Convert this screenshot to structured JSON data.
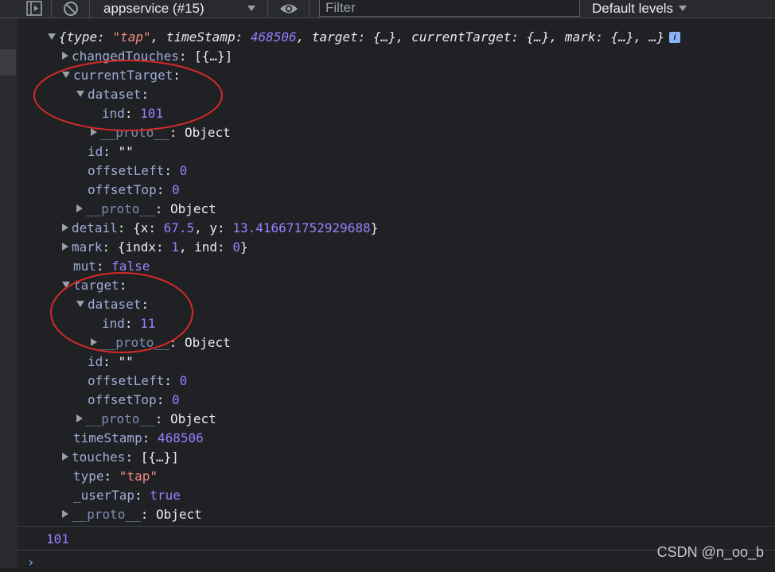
{
  "toolbar": {
    "context": "appservice (#15)",
    "filter_placeholder": "Filter",
    "levels": "Default levels"
  },
  "summary": {
    "open": "{",
    "type_key": "type",
    "type_val": "\"tap\"",
    "ts_key": "timeStamp",
    "ts_val": "468506",
    "target_key": "target",
    "target_val": "{…}",
    "ct_key": "currentTarget",
    "ct_val": "{…}",
    "mark_key": "mark",
    "mark_val": "{…}",
    "tail": ", …}",
    "info": "i"
  },
  "tree": {
    "changedTouches_key": "changedTouches",
    "changedTouches_val": "[{…}]",
    "currentTarget_key": "currentTarget",
    "ct_dataset_key": "dataset",
    "ct_ind_key": "ind",
    "ct_ind_val": "101",
    "proto_key": "__proto__",
    "proto_val": "Object",
    "id_key": "id",
    "id_val": "\"\"",
    "offsetLeft_key": "offsetLeft",
    "offsetLeft_val": "0",
    "offsetTop_key": "offsetTop",
    "offsetTop_val": "0",
    "detail_key": "detail",
    "detail_x_key": "x",
    "detail_x_val": "67.5",
    "detail_y_key": "y",
    "detail_y_val": "13.416671752929688",
    "mark_key": "mark",
    "mark_indx_key": "indx",
    "mark_indx_val": "1",
    "mark_ind_key": "ind",
    "mark_ind_val": "0",
    "mut_key": "mut",
    "mut_val": "false",
    "target_key": "target",
    "t_dataset_key": "dataset",
    "t_ind_key": "ind",
    "t_ind_val": "11",
    "timeStamp_key": "timeStamp",
    "timeStamp_val": "468506",
    "touches_key": "touches",
    "touches_val": "[{…}]",
    "type_key": "type",
    "type_val": "\"tap\"",
    "userTap_key": "_userTap",
    "userTap_val": "true"
  },
  "result_value": "101",
  "prompt": "›",
  "watermark": "CSDN @n_oo_b",
  "colors": {
    "background": "#202124",
    "key": "#9eacd6",
    "number": "#9980ff",
    "string": "#f28b82",
    "annotation": "#d42a2a"
  }
}
